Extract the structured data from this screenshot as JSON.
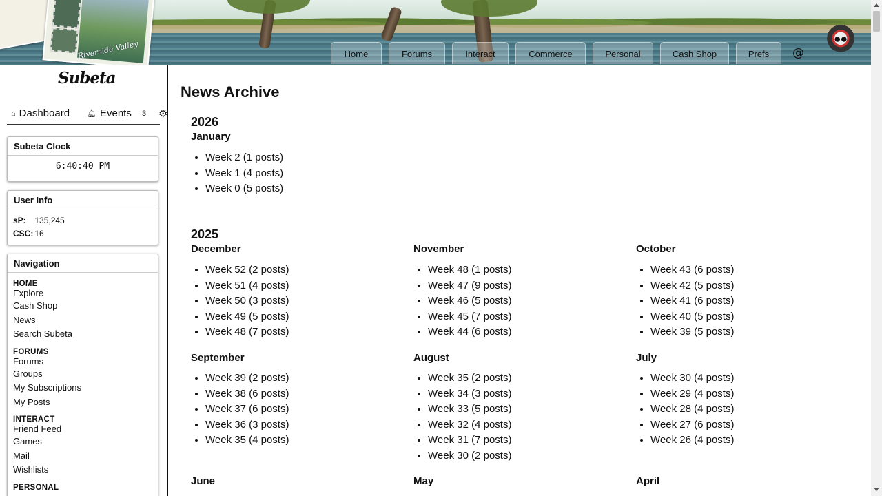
{
  "banner": {
    "postcard_text_1": "Riverside",
    "postcard_text_2": "Riverside Valley",
    "nav": [
      {
        "label": "Home"
      },
      {
        "label": "Forums"
      },
      {
        "label": "Interact"
      },
      {
        "label": "Commerce"
      },
      {
        "label": "Personal"
      },
      {
        "label": "Cash Shop"
      },
      {
        "label": "Prefs"
      }
    ],
    "at_symbol": "@"
  },
  "sidebar": {
    "logo": "Subeta",
    "dashboard_label": "Dashboard",
    "events_label": "Events",
    "events_count": "3",
    "clock": {
      "title": "Subeta Clock",
      "time": "6:40:40 PM"
    },
    "user_info": {
      "title": "User Info",
      "sp_label": "sP:",
      "sp_value": "135,245",
      "csc_label": "CSC:",
      "csc_value": "16"
    },
    "navigation": {
      "title": "Navigation",
      "sections": [
        {
          "heading": "HOME",
          "links": [
            "Explore",
            "Cash Shop",
            "News",
            "Search Subeta"
          ]
        },
        {
          "heading": "FORUMS",
          "links": [
            "Forums",
            "Groups",
            "My Subscriptions",
            "My Posts"
          ]
        },
        {
          "heading": "INTERACT",
          "links": [
            "Friend Feed",
            "Games",
            "Mail",
            "Wishlists"
          ]
        },
        {
          "heading": "PERSONAL",
          "links": []
        }
      ]
    }
  },
  "main": {
    "title": "News Archive",
    "years": [
      {
        "year": "2026",
        "months": [
          {
            "name": "January",
            "weeks": [
              "Week 2 (1 posts)",
              "Week 1 (4 posts)",
              "Week 0 (5 posts)"
            ]
          }
        ]
      },
      {
        "year": "2025",
        "months": [
          {
            "name": "December",
            "weeks": [
              "Week 52 (2 posts)",
              "Week 51 (4 posts)",
              "Week 50 (3 posts)",
              "Week 49 (5 posts)",
              "Week 48 (7 posts)"
            ]
          },
          {
            "name": "November",
            "weeks": [
              "Week 48 (1 posts)",
              "Week 47 (9 posts)",
              "Week 46 (5 posts)",
              "Week 45 (7 posts)",
              "Week 44 (6 posts)"
            ]
          },
          {
            "name": "October",
            "weeks": [
              "Week 43 (6 posts)",
              "Week 42 (5 posts)",
              "Week 41 (6 posts)",
              "Week 40 (5 posts)",
              "Week 39 (5 posts)"
            ]
          },
          {
            "name": "September",
            "weeks": [
              "Week 39 (2 posts)",
              "Week 38 (6 posts)",
              "Week 37 (6 posts)",
              "Week 36 (3 posts)",
              "Week 35 (4 posts)"
            ]
          },
          {
            "name": "August",
            "weeks": [
              "Week 35 (2 posts)",
              "Week 34 (3 posts)",
              "Week 33 (5 posts)",
              "Week 32 (4 posts)",
              "Week 31 (7 posts)",
              "Week 30 (2 posts)"
            ]
          },
          {
            "name": "July",
            "weeks": [
              "Week 30 (4 posts)",
              "Week 29 (4 posts)",
              "Week 28 (4 posts)",
              "Week 27 (6 posts)",
              "Week 26 (4 posts)"
            ]
          },
          {
            "name": "June",
            "weeks": []
          },
          {
            "name": "May",
            "weeks": []
          },
          {
            "name": "April",
            "weeks": []
          }
        ]
      }
    ]
  }
}
